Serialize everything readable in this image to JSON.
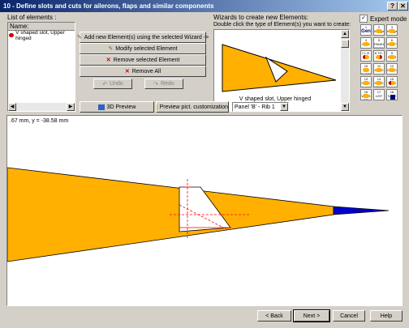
{
  "window": {
    "title": "10 - Define slots and cuts for ailerons, flaps and similar components",
    "help_btn": "?",
    "close_btn": "✕"
  },
  "elements_panel": {
    "label": "List of elements :",
    "column_header": "Name",
    "items": [
      "V shaped slot, Upper hinged"
    ]
  },
  "actions": {
    "add": "Add new Element(s) using the selected Wizard ->",
    "modify": "Modify selected Element",
    "remove": "Remove selected Element",
    "remove_all": "Remove All",
    "undo": "Undo",
    "redo": "Redo"
  },
  "wizards": {
    "label": "Wizards to create new Elements:",
    "instruction": "Double click the  type of Element(s) you want to create:",
    "preview_caption": "V shaped slot, Upper hinged",
    "expert_mode": "Expert mode",
    "tiles": [
      [
        "1",
        "2 Wedge",
        "3 Wedge"
      ],
      [
        "4 RIBS",
        "5 PANEL EDITING",
        "6 SHEET"
      ],
      [
        "7 L.E.",
        "8 T.E.",
        "9 SPAR"
      ],
      [
        "10 OIL SLOTS",
        "11 DECK",
        "12 GEODE"
      ],
      [
        "13 HOLE",
        "14 DECK HOLES",
        "15 TABS"
      ],
      [
        "16 WING TIP",
        "17 LIST",
        "18 SAVE"
      ]
    ],
    "gen_label": "Gen"
  },
  "preview_bar": {
    "preview_3d": "3D Preview",
    "preview_custom": "Preview pict. customization",
    "panel_select": "Panel 'B' - Rib 1"
  },
  "canvas": {
    "coords": ".67 mm, y = -38.58 mm"
  },
  "footer": {
    "back": "< Back",
    "next": "Next >",
    "cancel": "Cancel",
    "help": "Help"
  },
  "colors": {
    "airfoil": "#ffb000",
    "tip": "#0000cc",
    "slot": "#ffffff",
    "marker": "#ff0000"
  }
}
